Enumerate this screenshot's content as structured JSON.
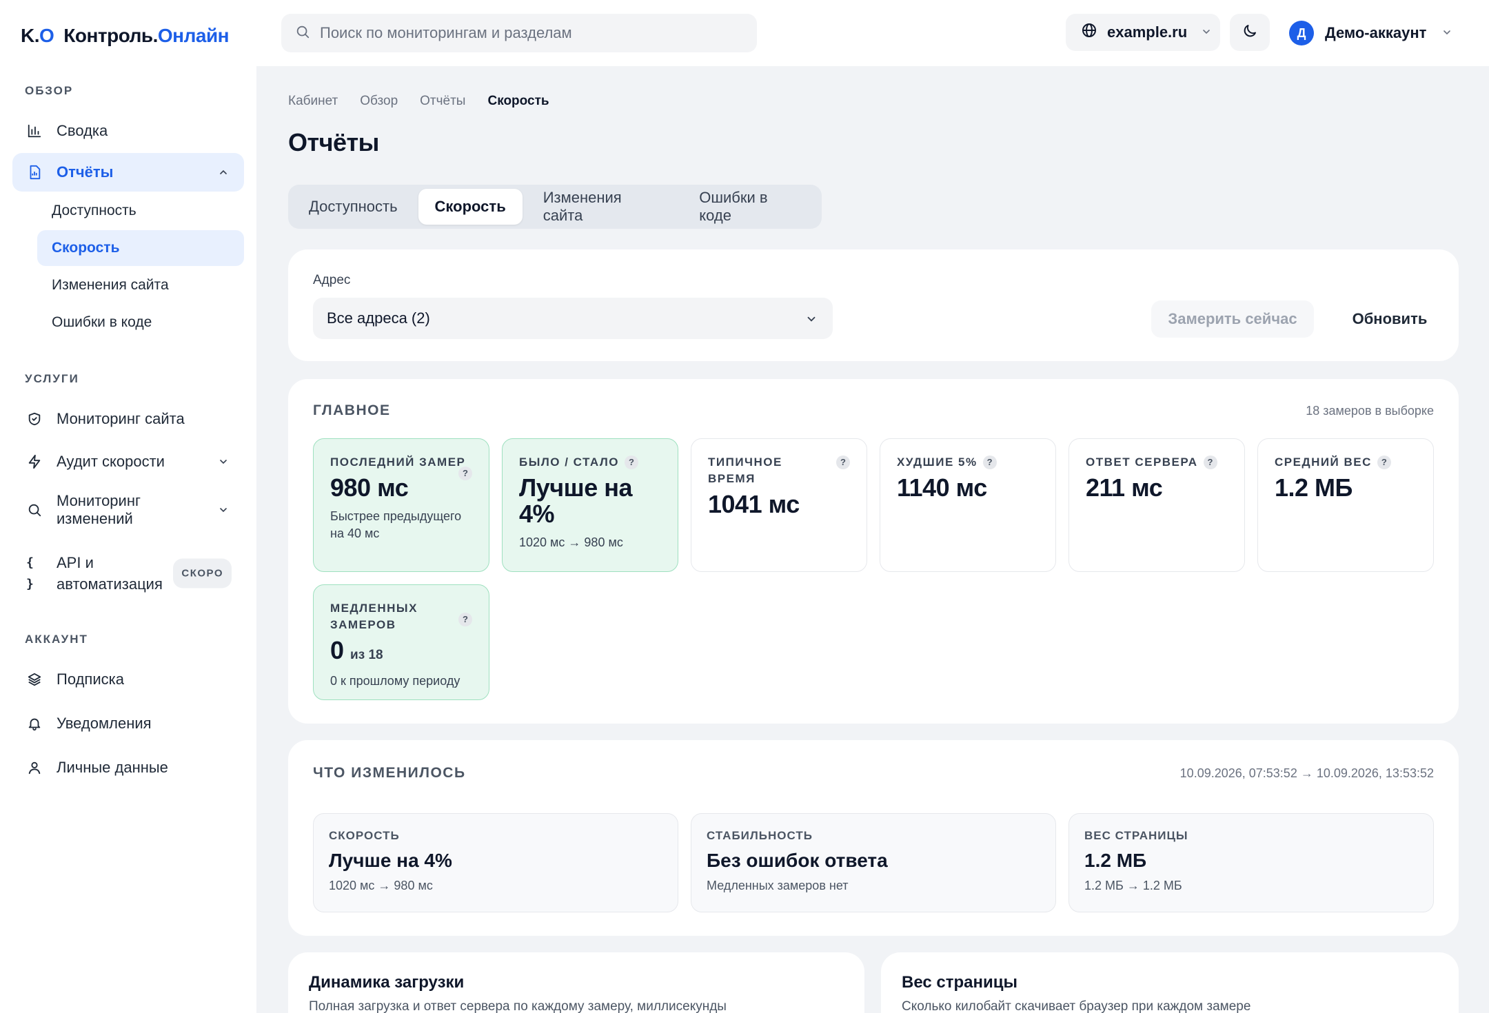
{
  "logo": {
    "mark_k": "K",
    "mark_o": "O",
    "name": "Контроль.",
    "name_accent": "Онлайн"
  },
  "search": {
    "placeholder": "Поиск по мониторингам и разделам"
  },
  "domain": {
    "label": "example.ru"
  },
  "account": {
    "initial": "Д",
    "name": "Демо-аккаунт"
  },
  "sidebar": {
    "overview_title": "ОБЗОР",
    "summary": "Сводка",
    "reports": "Отчёты",
    "reports_sub": [
      "Доступность",
      "Скорость",
      "Изменения сайта",
      "Ошибки в коде"
    ],
    "services_title": "УСЛУГИ",
    "site_monitoring": "Мониторинг сайта",
    "speed_audit": "Аудит скорости",
    "change_monitoring_l1": "Мониторинг",
    "change_monitoring_l2": "изменений",
    "api_l1": "API и",
    "api_l2": "автоматизация",
    "soon_badge": "СКОРО",
    "account_title": "АККАУНТ",
    "subscription": "Подписка",
    "notifications": "Уведомления",
    "personal": "Личные данные"
  },
  "breadcrumbs": [
    "Кабинет",
    "Обзор",
    "Отчёты",
    "Скорость"
  ],
  "page_title": "Отчёты",
  "tabs": [
    "Доступность",
    "Скорость",
    "Изменения сайта",
    "Ошибки в коде"
  ],
  "filter": {
    "address_label": "Адрес",
    "address_value": "Все адреса (2)",
    "measure_now": "Замерить сейчас",
    "refresh": "Обновить"
  },
  "main_section": {
    "title": "ГЛАВНОЕ",
    "meta": "18 замеров в выборке",
    "help": "?",
    "last": {
      "label": "Последний замер",
      "value": "980 мс",
      "sub": "Быстрее предыдущего на 40 мс"
    },
    "before_after": {
      "label": "Было / стало",
      "value_l1": "Лучше на",
      "value_l2": "4%",
      "sub": "1020 мс → 980 мс"
    },
    "typical": {
      "label": "Типичное время",
      "value": "1041 мс"
    },
    "worst": {
      "label": "Худшие 5%",
      "value": "1140 мс"
    },
    "server": {
      "label": "Ответ сервера",
      "value": "211 мс"
    },
    "weight": {
      "label": "Средний вес",
      "value": "1.2 МБ"
    },
    "slow": {
      "label": "Медленных замеров",
      "value": "0",
      "of": "из 18",
      "sub": "0 к прошлому периоду"
    }
  },
  "changes": {
    "title": "ЧТО ИЗМЕНИЛОСЬ",
    "period": "10.09.2026, 07:53:52 → 10.09.2026, 13:53:52",
    "items": [
      {
        "label": "Скорость",
        "value": "Лучше на 4%",
        "sub": "1020 мс → 980 мс"
      },
      {
        "label": "Стабильность",
        "value": "Без ошибок ответа",
        "sub": "Медленных замеров нет"
      },
      {
        "label": "Вес страницы",
        "value": "1.2 МБ",
        "sub": "1.2 МБ → 1.2 МБ"
      }
    ]
  },
  "panels": [
    {
      "title": "Динамика загрузки",
      "sub": "Полная загрузка и ответ сервера по каждому замеру, миллисекунды"
    },
    {
      "title": "Вес страницы",
      "sub": "Сколько килобайт скачивает браузер при каждом замере"
    }
  ],
  "colors": {
    "accent": "#1d5fe8",
    "good_bg": "#e7f7ef",
    "good_border": "#9ee0bf"
  }
}
